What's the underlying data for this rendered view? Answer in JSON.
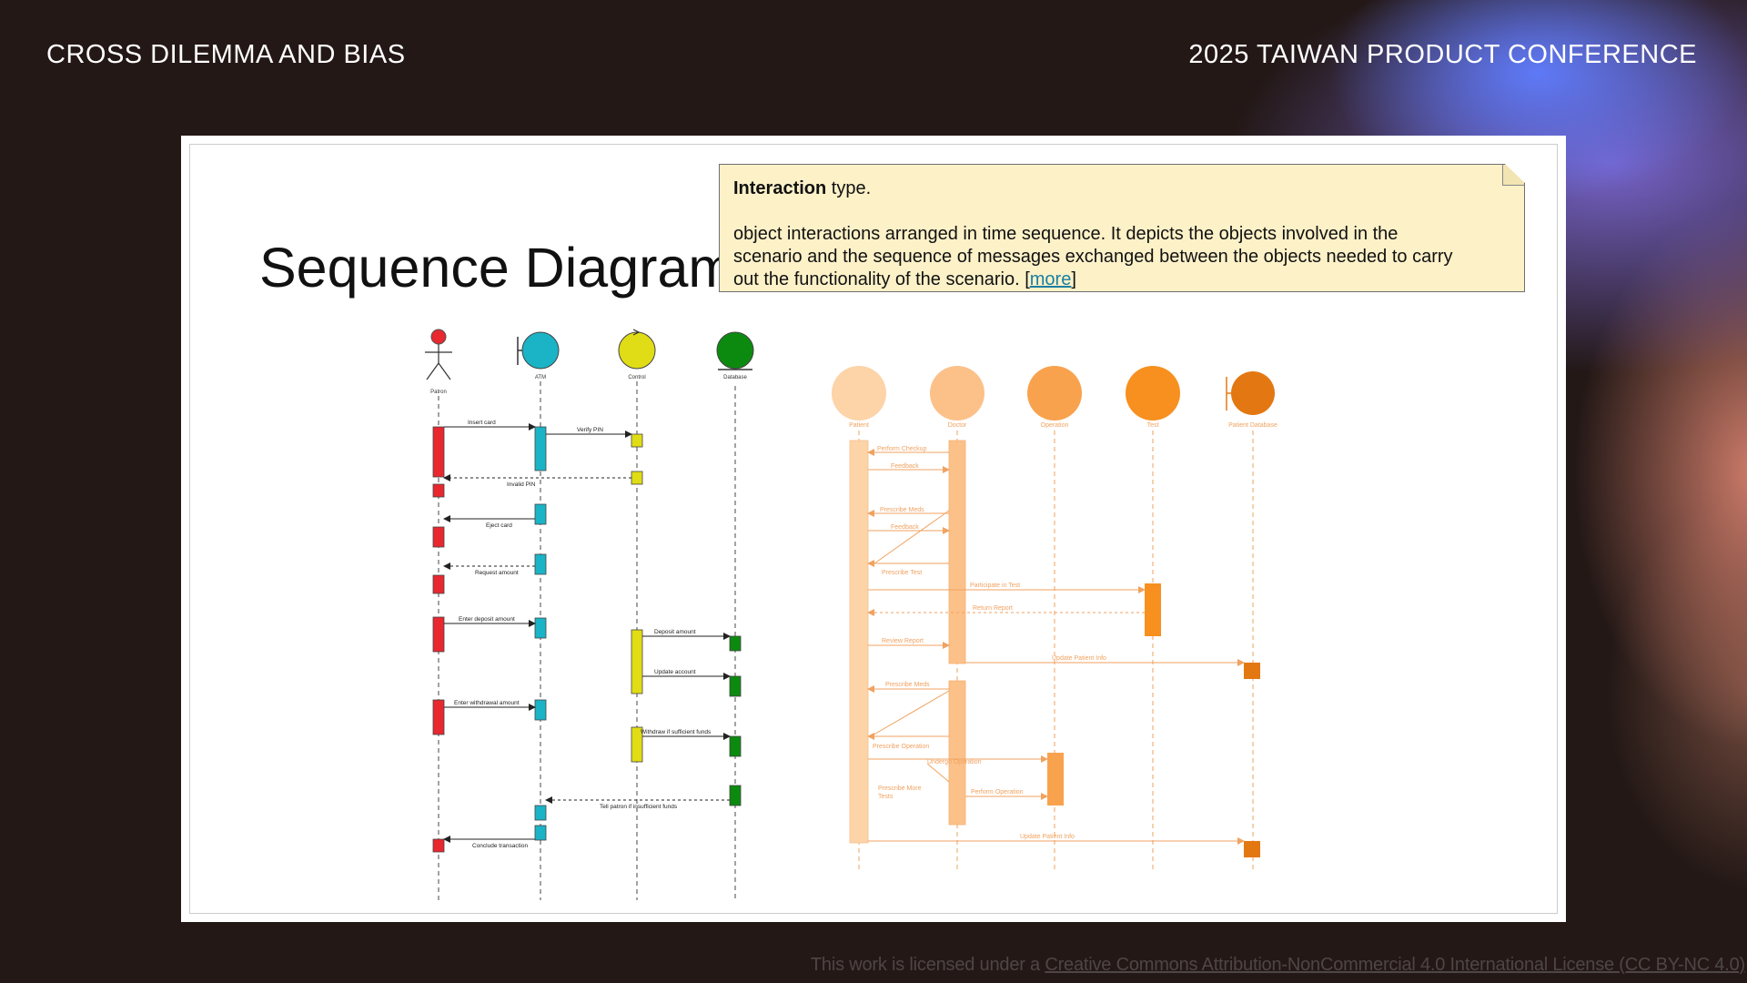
{
  "header": {
    "left_title": "CROSS DILEMMA AND BIAS",
    "right_title": "2025 TAIWAN PRODUCT CONFERENCE"
  },
  "slide": {
    "title": "Sequence Diagram",
    "tooltip": {
      "heading_bold": "Interaction",
      "heading_rest": " type.",
      "lines": [
        "object interactions arranged in time sequence. It depicts the objects involved in the",
        "scenario and the sequence of messages exchanged between the objects needed to carry"
      ],
      "last_line_prefix": "out the functionality of the scenario. [",
      "link_text": "more",
      "last_line_suffix": "]"
    }
  },
  "atm_diagram": {
    "participants": [
      {
        "label": "Patron",
        "kind": "actor",
        "color": "#e8272f"
      },
      {
        "label": "ATM",
        "kind": "boundary",
        "color": "#1bb3c6"
      },
      {
        "label": "Control",
        "kind": "control",
        "color": "#e0dc16"
      },
      {
        "label": "Database",
        "kind": "entity",
        "color": "#0c8a10"
      }
    ],
    "messages": [
      "Insert card",
      "Verify PIN",
      "Invalid PIN",
      "Eject card",
      "Request amount",
      "Enter deposit amount",
      "Deposit amount",
      "Update account",
      "Enter withdrawal amount",
      "Withdraw if sufficient funds",
      "Tell patron if insufficient funds",
      "Conclude transaction"
    ]
  },
  "hospital_diagram": {
    "participants": [
      {
        "label": "Patient",
        "color": "#fdd3a8"
      },
      {
        "label": "Doctor",
        "color": "#fcc189"
      },
      {
        "label": "Operation",
        "color": "#f9a24e"
      },
      {
        "label": "Test",
        "color": "#f7901f"
      },
      {
        "label": "Patient Database",
        "color": "#e37813"
      }
    ],
    "messages": [
      "Perform Checkup",
      "Feedback",
      "Prescribe Meds",
      "Feedback",
      "Prescribe Test",
      "Participate in Test",
      "Return Report",
      "Review Report",
      "Update Patient Info",
      "Prescribe Meds",
      "Prescribe Operation",
      "Undergo Operation",
      "Prescribe More",
      "Tests",
      "Perform Operation",
      "Update Patient Info"
    ]
  },
  "license": {
    "prefix": "This work is licensed under a ",
    "link_text": "Creative Commons Attribution-NonCommercial 4.0 International License (CC BY-NC 4.0)"
  },
  "colors": {
    "background": "#231816",
    "tooltip_bg": "#fdf1c8",
    "link": "#1a7fa3",
    "orange_line": "#f0a260"
  }
}
